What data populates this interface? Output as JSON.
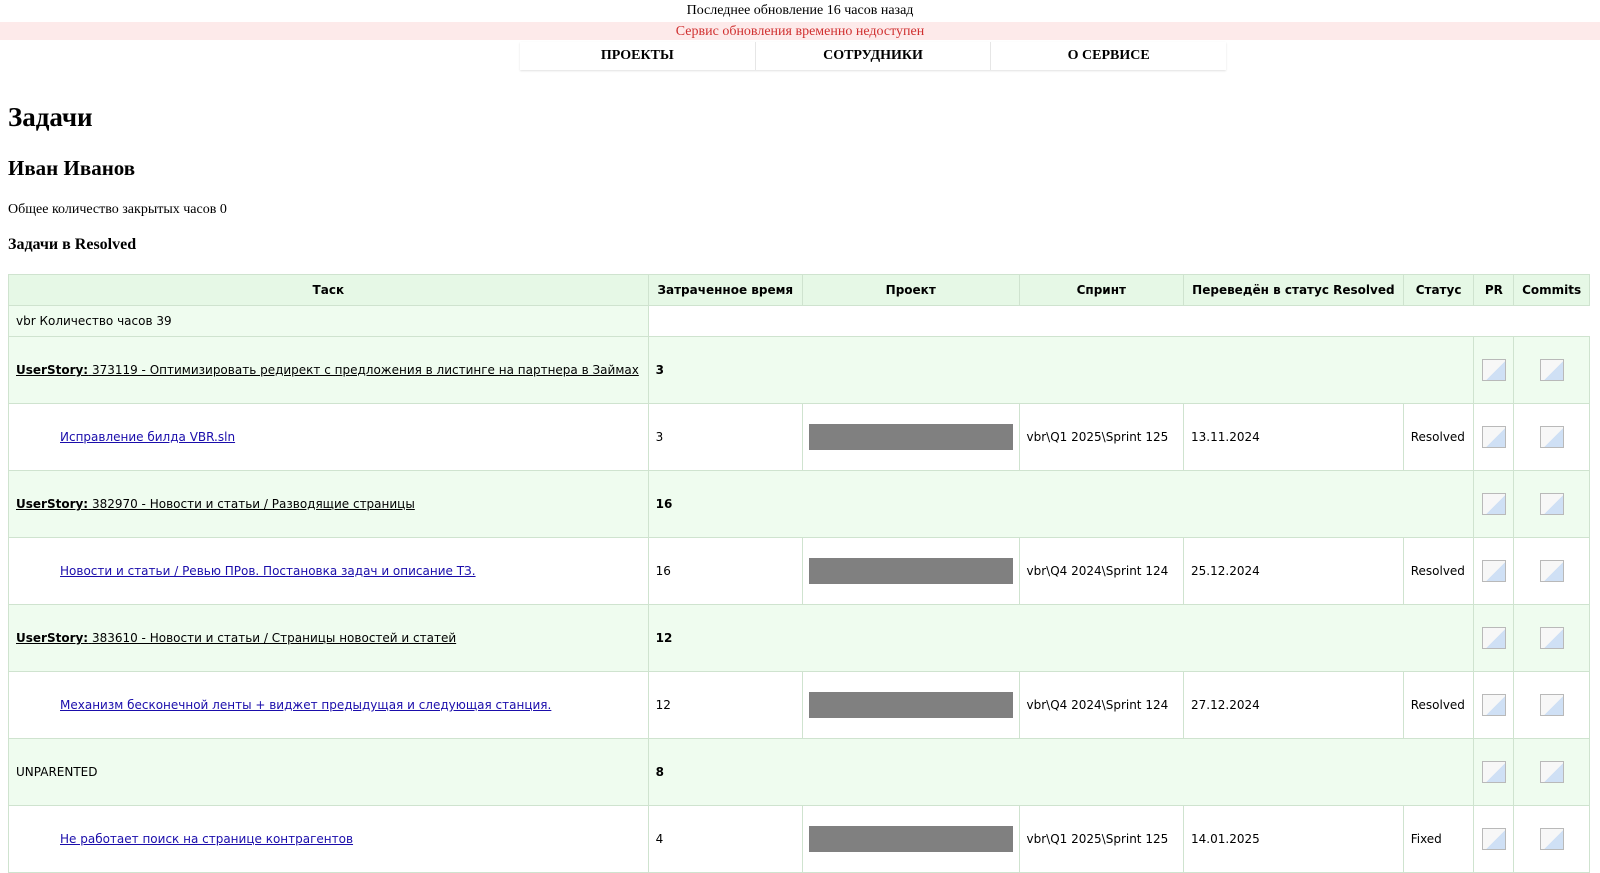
{
  "header": {
    "last_update": "Последнее обновление 16 часов назад",
    "service_alert": "Сервис обновления временно недоступен"
  },
  "nav": {
    "items": [
      {
        "label": "ПРОЕКТЫ"
      },
      {
        "label": "СОТРУДНИКИ"
      },
      {
        "label": "О СЕРВИСЕ"
      }
    ]
  },
  "page": {
    "title": "Задачи",
    "user": "Иван Иванов",
    "hours_total": "Общее количество закрытых часов 0",
    "section_title": "Задачи в Resolved"
  },
  "table": {
    "columns": [
      "Таск",
      "Затраченное время",
      "Проект",
      "Спринт",
      "Переведён в статус Resolved",
      "Статус",
      "PR",
      "Commits"
    ],
    "project_label": "vbr Количество часов 39",
    "rows": [
      {
        "type": "group",
        "prefix": "UserStory:",
        "label": "373119 - Оптимизировать редирект с предложения в листинге на партнера в Займах",
        "time": "3"
      },
      {
        "type": "item",
        "label": "Исправление билда VBR.sln",
        "time": "3",
        "sprint": "vbr\\Q1 2025\\Sprint 125",
        "date": "13.11.2024",
        "status": "Resolved"
      },
      {
        "type": "group",
        "prefix": "UserStory:",
        "label": "382970 - Новости и статьи / Разводящие страницы",
        "time": "16"
      },
      {
        "type": "item",
        "label": "Новости и статьи / Ревью ПРов. Постановка задач и описание ТЗ.",
        "time": "16",
        "sprint": "vbr\\Q4 2024\\Sprint 124",
        "date": "25.12.2024",
        "status": "Resolved"
      },
      {
        "type": "group",
        "prefix": "UserStory:",
        "label": "383610 - Новости и статьи / Страницы новостей и статей",
        "time": "12"
      },
      {
        "type": "item",
        "label": "Механизм бесконечной ленты + виджет предыдущая и следующая станция.",
        "time": "12",
        "sprint": "vbr\\Q4 2024\\Sprint 124",
        "date": "27.12.2024",
        "status": "Resolved"
      },
      {
        "type": "group",
        "prefix": "",
        "label": "UNPARENTED",
        "time": "8"
      },
      {
        "type": "item",
        "label": "Не работает поиск на странице контрагентов",
        "time": "4",
        "sprint": "vbr\\Q1 2025\\Sprint 125",
        "date": "14.01.2025",
        "status": "Fixed"
      }
    ]
  },
  "colors": {
    "header_bg": "#e6f8e6",
    "group_bg": "#effcef",
    "alert_bg": "#fdeaea",
    "alert_text": "#d03030",
    "link": "#1a0dab",
    "redaction": "#808080"
  }
}
